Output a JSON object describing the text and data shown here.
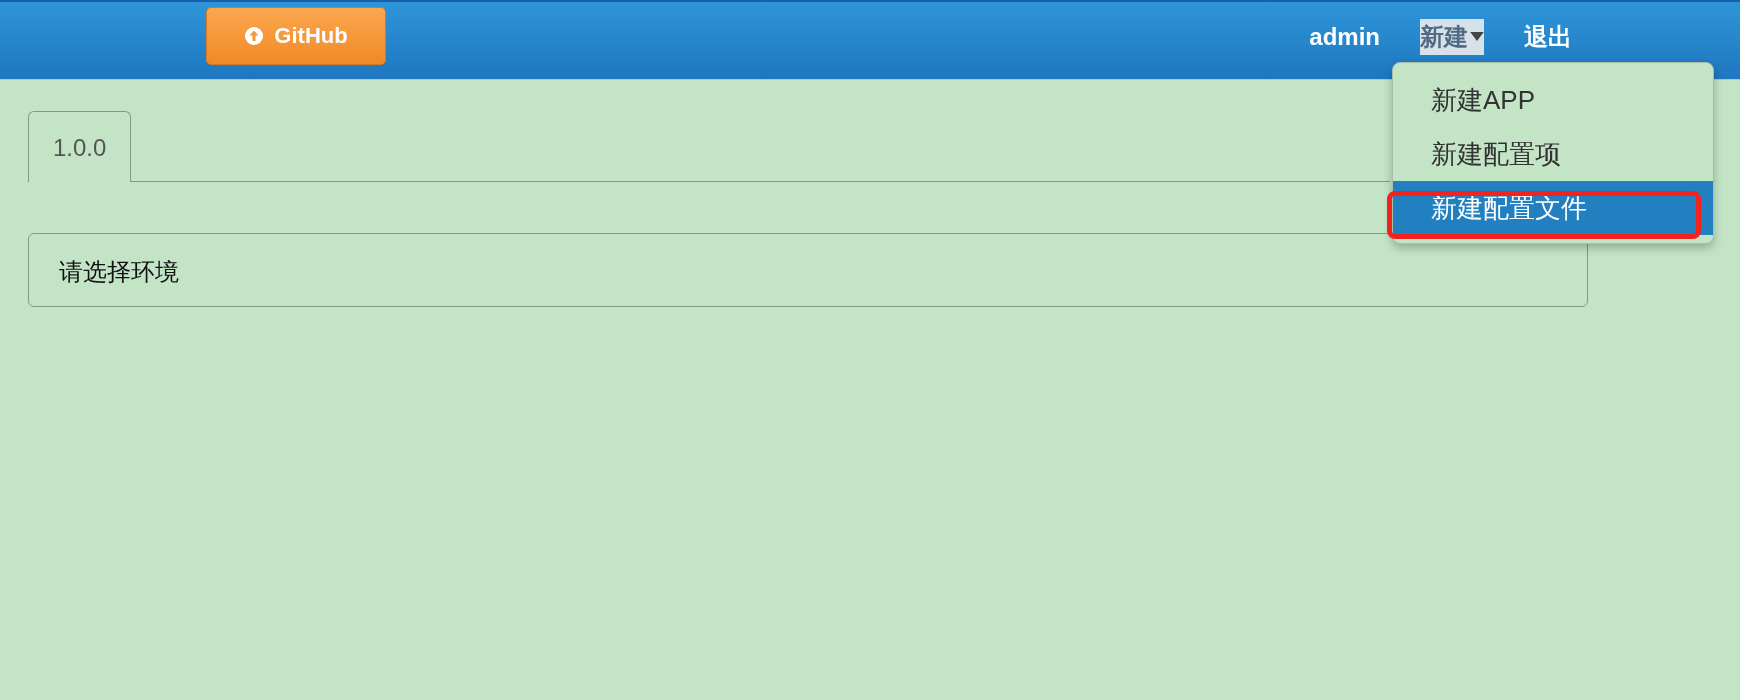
{
  "navbar": {
    "github_button": {
      "label": "GitHub"
    },
    "items": [
      {
        "label": "admin",
        "kind": "link",
        "open": false
      },
      {
        "label": "新建",
        "kind": "dropdown",
        "open": true
      },
      {
        "label": "退出",
        "kind": "link",
        "open": false
      }
    ]
  },
  "dropdown_menu": {
    "items": [
      {
        "label": "新建APP",
        "selected": false,
        "annotated": false
      },
      {
        "label": "新建配置项",
        "selected": false,
        "annotated": false
      },
      {
        "label": "新建配置文件",
        "selected": true,
        "annotated": true
      }
    ]
  },
  "tabs": [
    {
      "label": "1.0.0",
      "selected": true
    }
  ],
  "alert": {
    "text": "请选择环境"
  }
}
